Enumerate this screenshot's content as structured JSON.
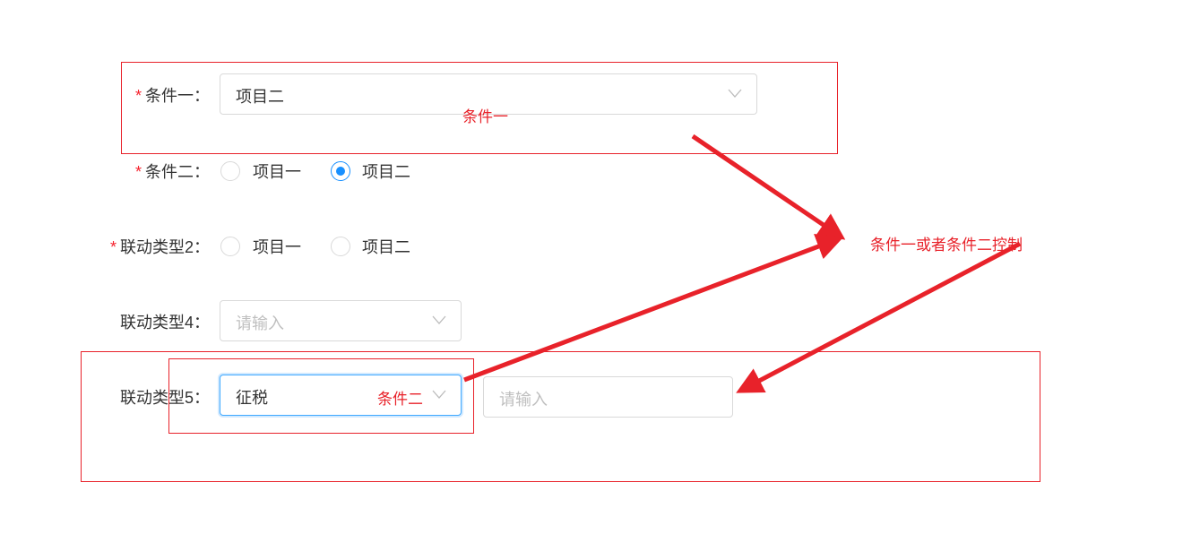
{
  "form": {
    "condition1": {
      "label": "条件一：",
      "required": true,
      "value": "项目二"
    },
    "condition2": {
      "label": "条件二：",
      "required": true,
      "options": [
        "项目一",
        "项目二"
      ],
      "selected": "项目二"
    },
    "linkage2": {
      "label": "联动类型2：",
      "required": true,
      "options": [
        "项目一",
        "项目二"
      ],
      "selected": null
    },
    "linkage4": {
      "label": "联动类型4：",
      "placeholder": "请输入"
    },
    "linkage5": {
      "label": "联动类型5：",
      "value": "征税",
      "input_placeholder": "请输入"
    }
  },
  "annotations": {
    "condition1_note": "条件一",
    "condition2_note": "条件二",
    "control_note": "条件一或者条件二控制",
    "color": "#e8222a"
  },
  "colors": {
    "primary": "#1890ff",
    "required": "#f5222d"
  }
}
